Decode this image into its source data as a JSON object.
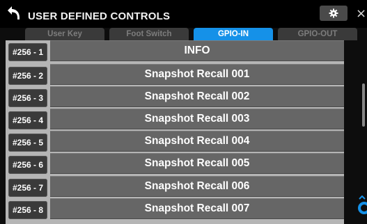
{
  "header": {
    "title": "USER DEFINED CONTROLS",
    "back_icon": "back-arrow-icon",
    "settings_icon": "gear-icon",
    "close_label": "×"
  },
  "tabs": [
    {
      "label": "User Key",
      "active": false
    },
    {
      "label": "Foot Switch",
      "active": false
    },
    {
      "label": "GPIO-IN",
      "active": true
    },
    {
      "label": "GPIO-OUT",
      "active": false
    }
  ],
  "rows": [
    {
      "num": "#256 - 1",
      "value": "INFO"
    },
    {
      "num": "#256 - 2",
      "value": "Snapshot Recall 001"
    },
    {
      "num": "#256 - 3",
      "value": "Snapshot Recall 002"
    },
    {
      "num": "#256 - 4",
      "value": "Snapshot Recall 003"
    },
    {
      "num": "#256 - 5",
      "value": "Snapshot Recall 004"
    },
    {
      "num": "#256 - 6",
      "value": "Snapshot Recall 005"
    },
    {
      "num": "#256 - 7",
      "value": "Snapshot Recall 006"
    },
    {
      "num": "#256 - 8",
      "value": "Snapshot Recall 007"
    }
  ],
  "colors": {
    "accent": "#1591e8",
    "row_button": "#666666",
    "number_badge": "#3a3a3a"
  }
}
